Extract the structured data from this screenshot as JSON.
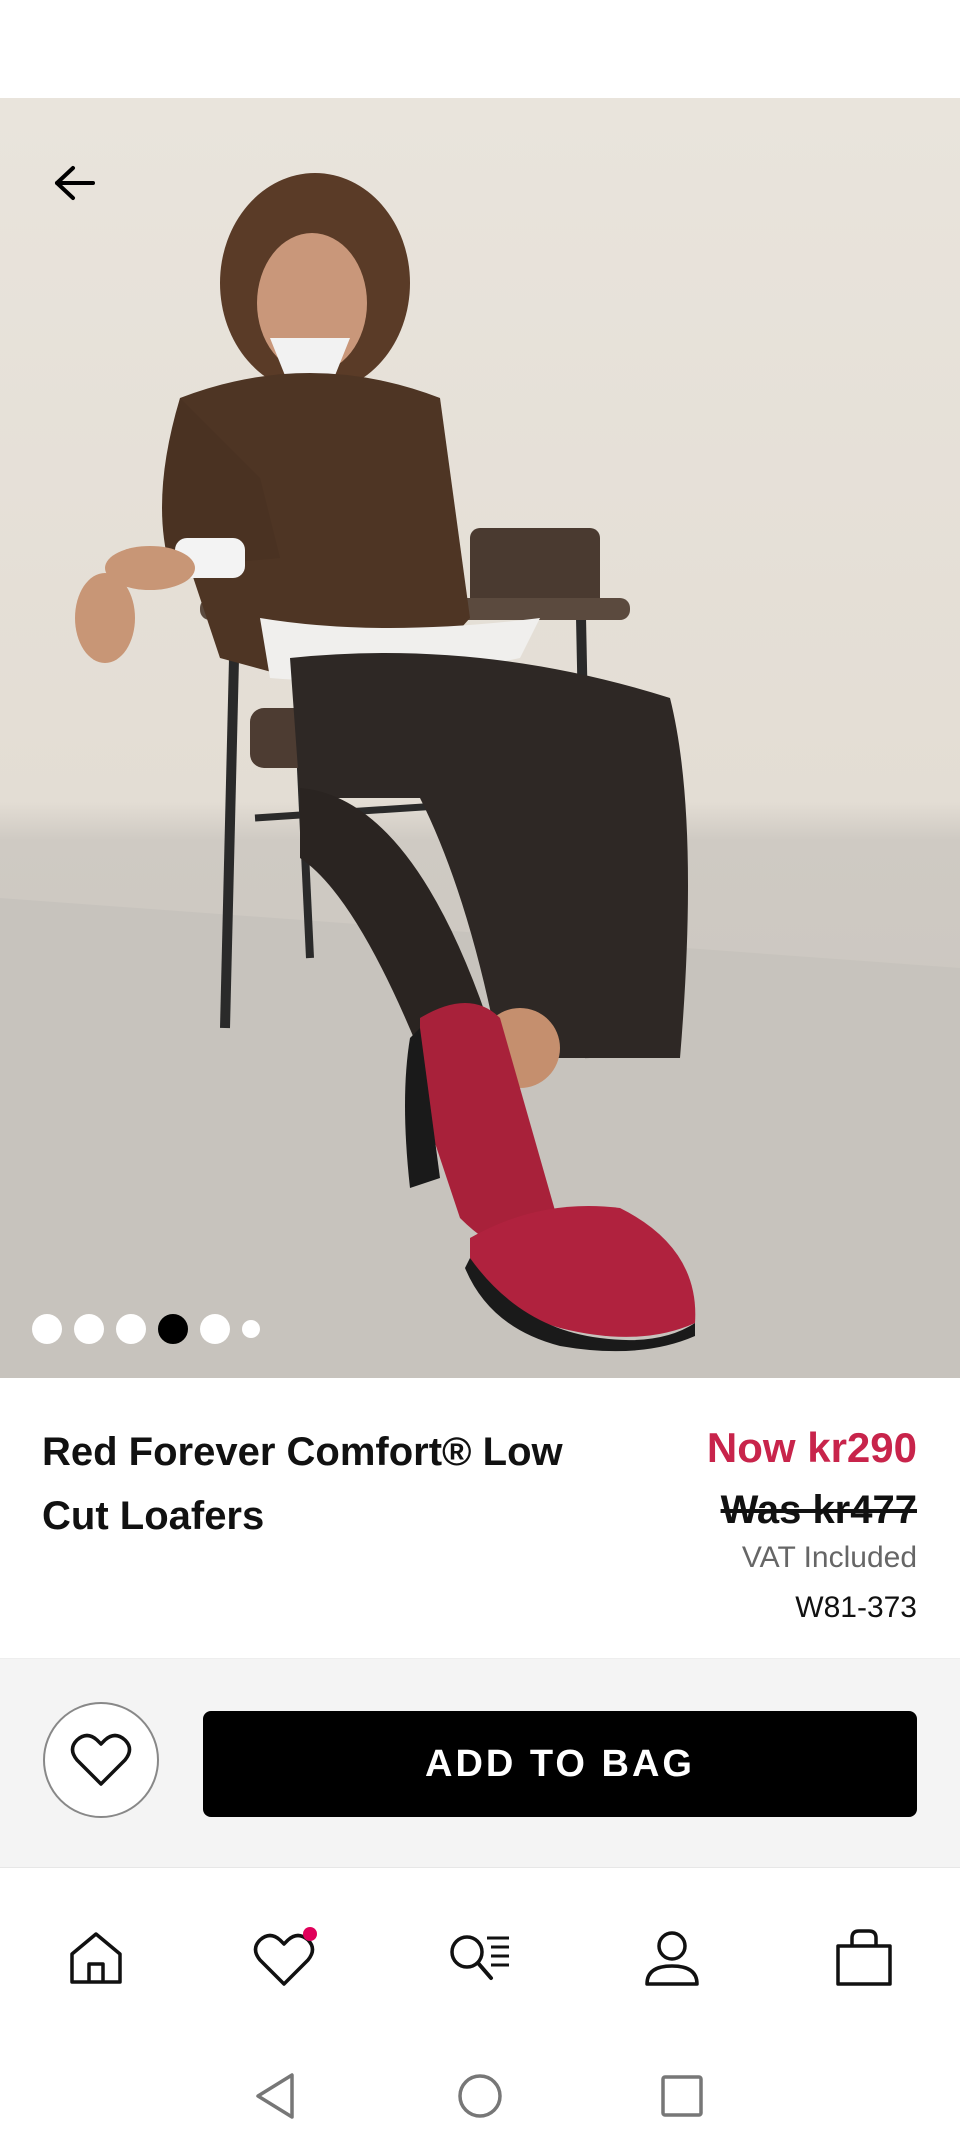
{
  "product": {
    "title": "Red Forever Comfort® Low Cut Loafers",
    "price_now": "Now kr290",
    "price_was": "Was kr477",
    "vat_note": "VAT Included",
    "sku": "W81-373"
  },
  "gallery": {
    "image_count": 6,
    "active_index": 3
  },
  "actions": {
    "add_to_bag_label": "ADD TO BAG"
  },
  "icons": {
    "back": "arrow-left-icon",
    "wishlist": "heart-icon",
    "home": "home-icon",
    "favourites": "heart-icon",
    "search": "search-list-icon",
    "account": "user-icon",
    "bag": "shopping-bag-icon"
  },
  "colors": {
    "price_accent": "#c8244b",
    "notification_dot": "#e0005a",
    "cta_background": "#000000"
  }
}
